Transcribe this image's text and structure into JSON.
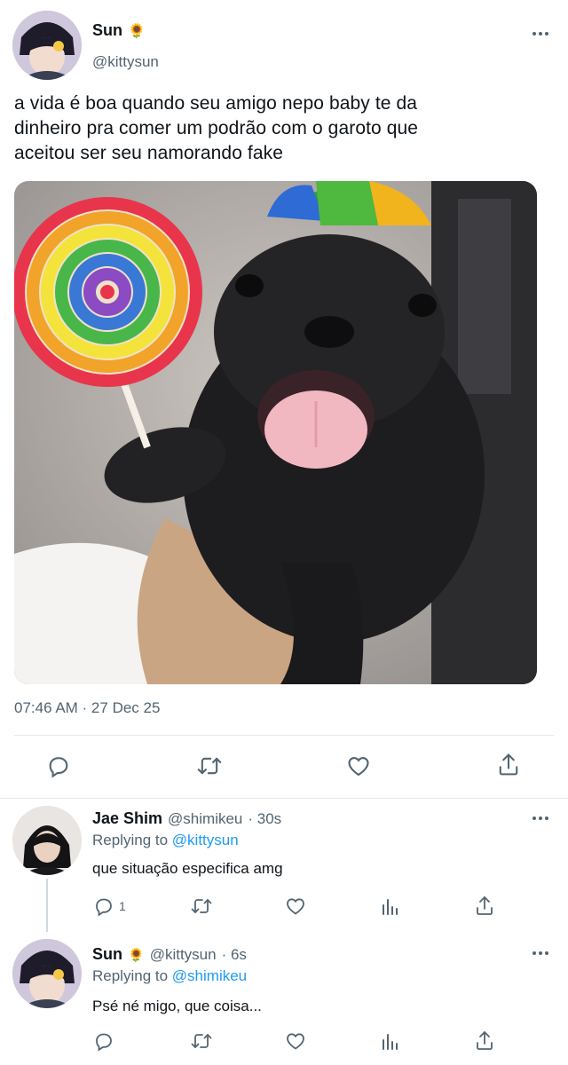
{
  "post": {
    "author_name": "Sun",
    "author_emoji": "🌻",
    "author_handle": "@kittysun",
    "text_lines": [
      "a vida é boa quando seu amigo nepo baby te da",
      "dinheiro pra comer um podrão com o garoto que",
      "aceitou ser seu namorando fake"
    ],
    "timestamp": "07:46 AM · 27 Dec 25",
    "actions": [
      "reply-icon",
      "retweet-icon",
      "like-icon",
      "share-icon"
    ]
  },
  "replies": [
    {
      "author_name": "Jae Shim",
      "author_handle": "@shimikeu",
      "time": "· 30s",
      "replying_prefix": "Replying to",
      "replying_to": "@kittysun",
      "text": "que situação especifica amg",
      "reply_count": "1"
    },
    {
      "author_name": "Sun",
      "author_emoji": "🌻",
      "author_handle": "@kittysun",
      "time": "· 6s",
      "replying_prefix": "Replying to",
      "replying_to": "@shimikeu",
      "text": "Psé né migo, que coisa..."
    }
  ],
  "colors": {
    "text": "#0f1419",
    "muted": "#536471",
    "link": "#1d9bf0",
    "divider": "#e7e9ea"
  }
}
